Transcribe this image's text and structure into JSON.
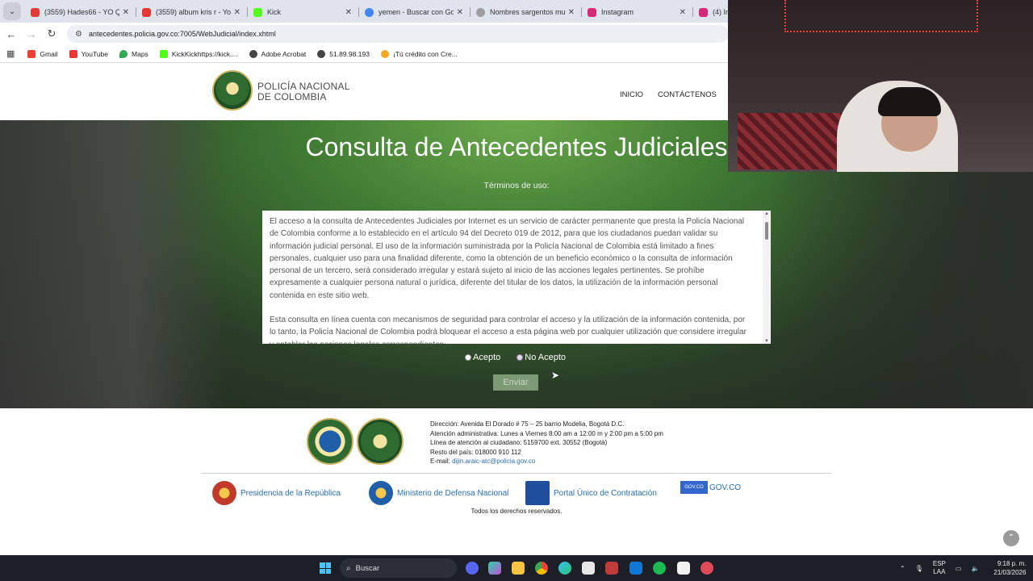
{
  "browser": {
    "tabs": [
      {
        "title": "(3559) Hades66 - YO QUIE",
        "color": "#e53935"
      },
      {
        "title": "(3559) album kris r - YouT",
        "color": "#e53935"
      },
      {
        "title": "Kick",
        "color": "#53fc18"
      },
      {
        "title": "yemen - Buscar con Goog",
        "color": "#4285f4"
      },
      {
        "title": "Nombres sargentos muje",
        "color": "#9e9e9e"
      },
      {
        "title": "Instagram",
        "color": "#d62976"
      },
      {
        "title": "(4) Inst",
        "color": "#d62976"
      }
    ],
    "url": "antecedentes.policia.gov.co:7005/WebJudicial/index.xhtml",
    "bookmarks": [
      {
        "label": "Gmail",
        "color": "#ea4335"
      },
      {
        "label": "YouTube",
        "color": "#e53935"
      },
      {
        "label": "Maps",
        "color": "#34a853"
      },
      {
        "label": "KickKickhttps://kick....",
        "color": "#53fc18"
      },
      {
        "label": "Adobe Acrobat",
        "color": "#444444"
      },
      {
        "label": "51.89.98.193",
        "color": "#444444"
      },
      {
        "label": "¡Tú crédito con Cre...",
        "color": "#f5a623"
      }
    ]
  },
  "site": {
    "logo_line1": "POLICÍA NACIONAL",
    "logo_line2": "DE COLOMBIA",
    "nav": [
      "INICIO",
      "CONTÁCTENOS",
      "F"
    ]
  },
  "hero": {
    "title": "Consulta de Antecedentes Judiciales",
    "terms_label": "Términos de uso:",
    "terms_p1": "El acceso a la consulta de Antecedentes Judiciales por Internet es un servicio de carácter permanente que presta la Policía Nacional de Colombia conforme a lo establecido en el artículo 94 del Decreto 019 de 2012, para que los ciudadanos puedan validar su información judicial personal. El uso de la información suministrada por la Policía Nacional de Colombia está limitado a fines personales, cualquier uso para una finalidad diferente, como la obtención de un beneficio económico o la consulta de información personal de un tercero, será considerado irregular y estará sujeto al inicio de las acciones legales pertinentes. Se prohíbe expresamente a cualquier persona natural o jurídica, diferente del titular de los datos, la utilización de la información personal contenida en este sitio web.",
    "terms_p2": "Esta consulta en línea cuenta con mecanismos de seguridad para controlar el acceso y la utilización de la información contenida, por lo tanto, la Policía Nacional de Colombia podrá bloquear el acceso a esta página web por cualquier utilización que considere irregular y entablar las acciones legales correspondientes.",
    "accept": "Acepto",
    "reject": "No Acepto",
    "submit": "Enviar"
  },
  "footer": {
    "address": "Dirección: Avenida El Dorado # 75 – 25 barrio Modelia, Bogotá D.C.",
    "hours": "Atención administrativa: Lunes a Viernes 8:00 am a 12:00 m y 2:00 pm a 5:00 pm",
    "phone": "Línea de atención al ciudadano: 5159700 ext. 30552 (Bogotá)",
    "country": "Resto del país: 018000 910 112",
    "email_label": "E-mail:",
    "email": "dijin.araic-atc@policia.gov.co",
    "links": {
      "presidencia": "Presidencia de la República",
      "mindefensa": "Ministerio de Defensa Nacional",
      "contratacion": "Portal Único de Contratación",
      "govco": "GOV.CO",
      "govco_badge": "GOV.CO"
    },
    "rights": "Todos los derechos reservados."
  },
  "taskbar": {
    "search": "Buscar",
    "lang1": "ESP",
    "lang2": "LAA",
    "time": "9:18 p. m.",
    "date": "21/03/2026"
  }
}
